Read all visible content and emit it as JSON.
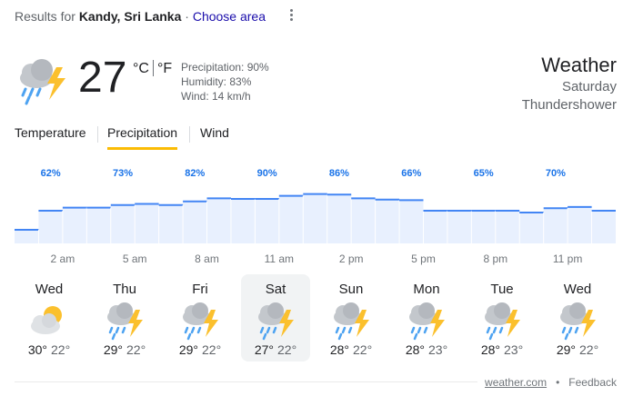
{
  "header": {
    "results_for": "Results for",
    "location": "Kandy, Sri Lanka",
    "separator": " · ",
    "choose_area": "Choose area"
  },
  "current": {
    "icon": "thundershower-icon",
    "temperature": "27",
    "unit_c": "°C",
    "unit_f": "°F",
    "precipitation": "Precipitation: 90%",
    "humidity": "Humidity: 83%",
    "wind": "Wind: 14 km/h"
  },
  "summary": {
    "title": "Weather",
    "day": "Saturday",
    "condition": "Thundershower"
  },
  "tabs": [
    {
      "label": "Temperature",
      "active": false
    },
    {
      "label": "Precipitation",
      "active": true
    },
    {
      "label": "Wind",
      "active": false
    }
  ],
  "chart_data": {
    "type": "area",
    "title": "",
    "xlabel": "",
    "ylabel": "",
    "ylim": [
      0,
      100
    ],
    "x_tick_labels": [
      "2 am",
      "5 am",
      "8 am",
      "11 am",
      "2 pm",
      "5 pm",
      "8 pm",
      "11 pm"
    ],
    "x": [
      "12 am",
      "1 am",
      "2 am",
      "3 am",
      "4 am",
      "5 am",
      "6 am",
      "7 am",
      "8 am",
      "9 am",
      "10 am",
      "11 am",
      "12 pm",
      "1 pm",
      "2 pm",
      "3 pm",
      "4 pm",
      "5 pm",
      "6 pm",
      "7 pm",
      "8 pm",
      "9 pm",
      "10 pm",
      "11 pm",
      "12 am"
    ],
    "values": [
      22,
      53,
      58,
      58,
      62,
      64,
      62,
      68,
      73,
      72,
      72,
      77,
      80,
      79,
      73,
      71,
      70,
      53,
      53,
      53,
      53,
      50,
      57,
      59,
      53
    ],
    "data_labels": [
      {
        "index": 1,
        "text": "62%"
      },
      {
        "index": 4,
        "text": "73%"
      },
      {
        "index": 7,
        "text": "82%"
      },
      {
        "index": 10,
        "text": "90%"
      },
      {
        "index": 13,
        "text": "86%"
      },
      {
        "index": 16,
        "text": "66%"
      },
      {
        "index": 19,
        "text": "65%"
      },
      {
        "index": 22,
        "text": "70%"
      }
    ],
    "colors": {
      "line": "#4285f4",
      "fill": "#e8f0fe",
      "label": "#1a73e8"
    },
    "grid": false
  },
  "forecast": [
    {
      "day": "Wed",
      "icon": "partly-cloudy-icon",
      "high": "30°",
      "low": "22°",
      "selected": false
    },
    {
      "day": "Thu",
      "icon": "thundershower-icon",
      "high": "29°",
      "low": "22°",
      "selected": false
    },
    {
      "day": "Fri",
      "icon": "thundershower-icon",
      "high": "29°",
      "low": "22°",
      "selected": false
    },
    {
      "day": "Sat",
      "icon": "thundershower-icon",
      "high": "27°",
      "low": "22°",
      "selected": true
    },
    {
      "day": "Sun",
      "icon": "thundershower-icon",
      "high": "28°",
      "low": "22°",
      "selected": false
    },
    {
      "day": "Mon",
      "icon": "thundershower-icon",
      "high": "28°",
      "low": "23°",
      "selected": false
    },
    {
      "day": "Tue",
      "icon": "thundershower-icon",
      "high": "28°",
      "low": "23°",
      "selected": false
    },
    {
      "day": "Wed",
      "icon": "thundershower-icon",
      "high": "29°",
      "low": "22°",
      "selected": false
    }
  ],
  "footer": {
    "source": "weather.com",
    "dot": "•",
    "feedback": "Feedback"
  }
}
